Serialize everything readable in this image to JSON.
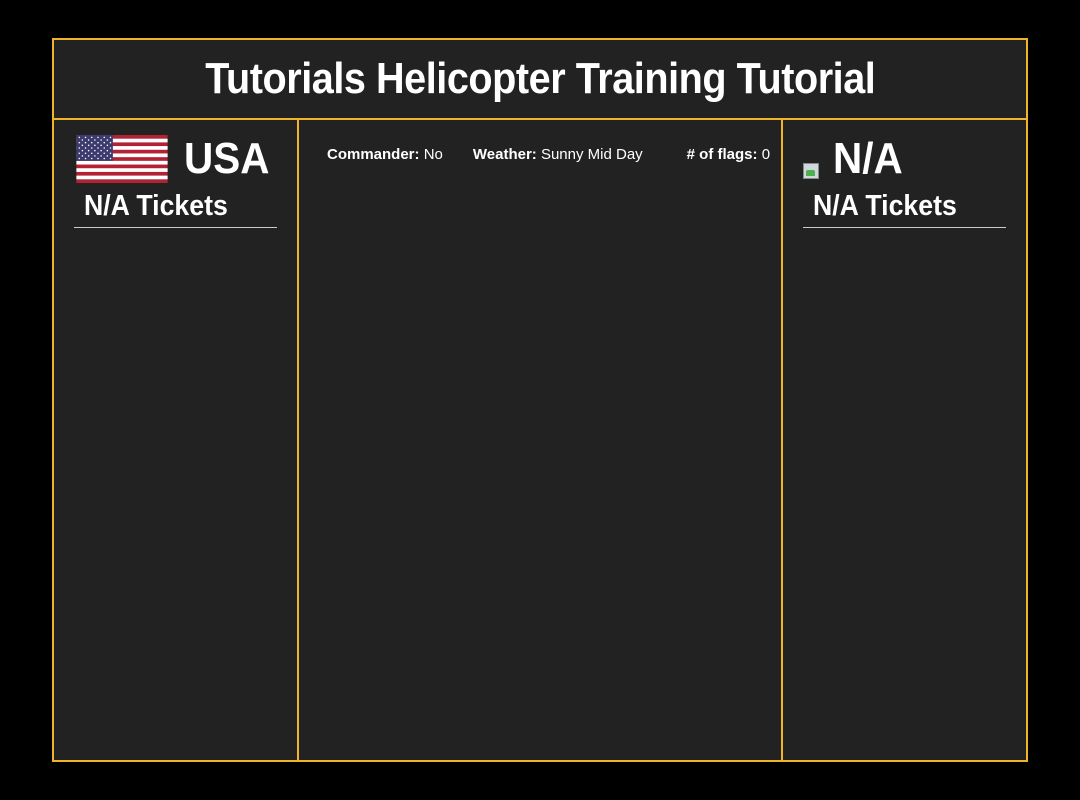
{
  "header": {
    "title": "Tutorials Helicopter Training Tutorial"
  },
  "team1": {
    "name": "USA",
    "tickets": "N/A Tickets",
    "flag_icon": "us-flag-icon"
  },
  "team2": {
    "name": "N/A",
    "tickets": "N/A Tickets",
    "flag_icon": "broken-image-icon"
  },
  "info": {
    "commander_label": "Commander:",
    "commander_value": "No",
    "weather_label": "Weather:",
    "weather_value": "Sunny Mid Day",
    "flags_label": "# of flags:",
    "flags_value": "0"
  },
  "colors": {
    "accent": "#f0b429",
    "panel_bg": "#222222",
    "page_bg": "#000000"
  }
}
